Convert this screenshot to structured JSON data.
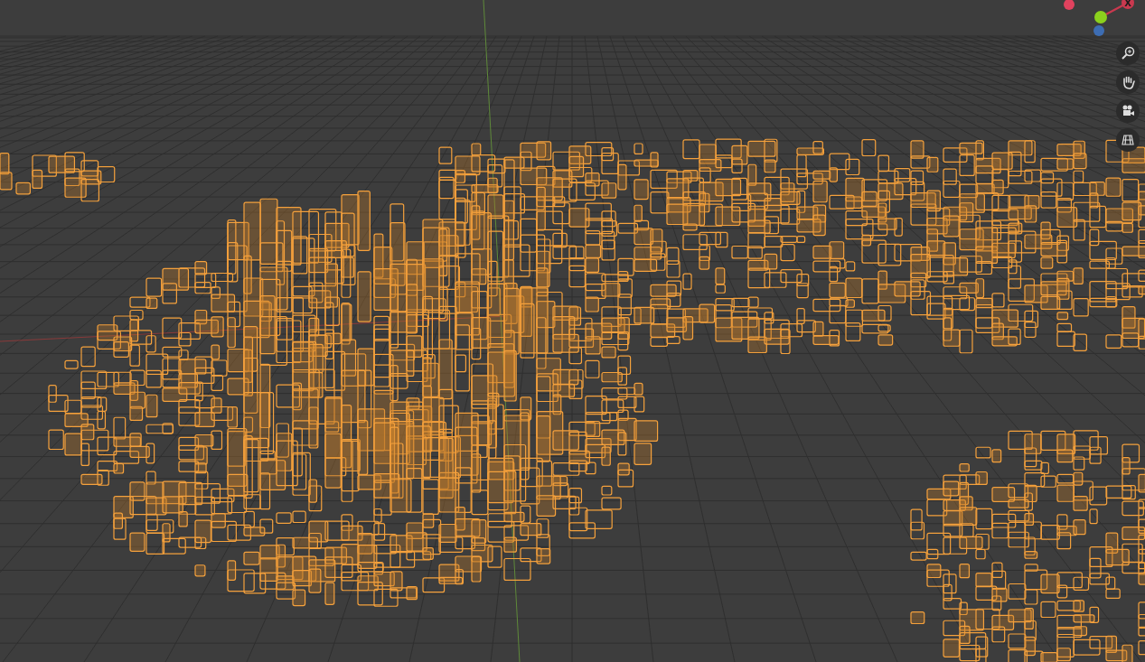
{
  "viewport": {
    "gizmo": {
      "axes": [
        {
          "kind": "negative",
          "color": "#e0425e"
        },
        {
          "kind": "positive",
          "label": "X",
          "color": "#c9394f"
        },
        {
          "kind": "positive",
          "color": "#8bd11d"
        },
        {
          "kind": "negative",
          "color": "#3d6db3"
        }
      ]
    }
  }
}
